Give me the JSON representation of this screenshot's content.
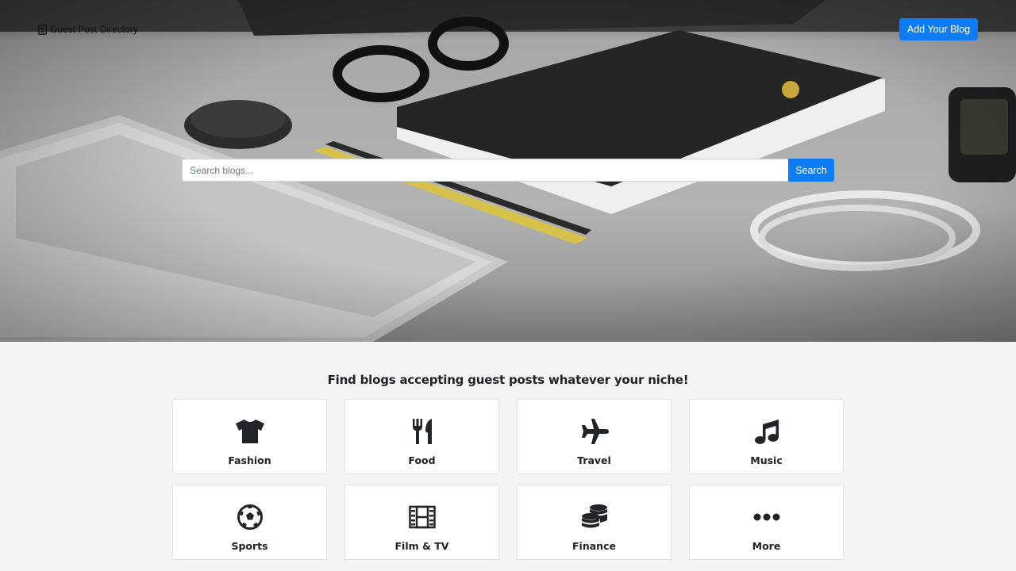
{
  "header": {
    "brand_label": "Guest Post Directory",
    "add_blog_label": "Add Your Blog"
  },
  "search": {
    "placeholder": "Search blogs...",
    "button_label": "Search"
  },
  "categories_section": {
    "heading": "Find blogs accepting guest posts whatever your niche!",
    "items": [
      {
        "label": "Fashion",
        "icon": "tshirt-icon"
      },
      {
        "label": "Food",
        "icon": "utensils-icon"
      },
      {
        "label": "Travel",
        "icon": "plane-icon"
      },
      {
        "label": "Music",
        "icon": "music-note-icon"
      },
      {
        "label": "Sports",
        "icon": "soccer-ball-icon"
      },
      {
        "label": "Film & TV",
        "icon": "film-icon"
      },
      {
        "label": "Finance",
        "icon": "coins-icon"
      },
      {
        "label": "More",
        "icon": "ellipsis-icon"
      }
    ]
  },
  "colors": {
    "accent": "#0d7df5",
    "page_background": "#f4f4f4",
    "card_background": "#ffffff"
  }
}
